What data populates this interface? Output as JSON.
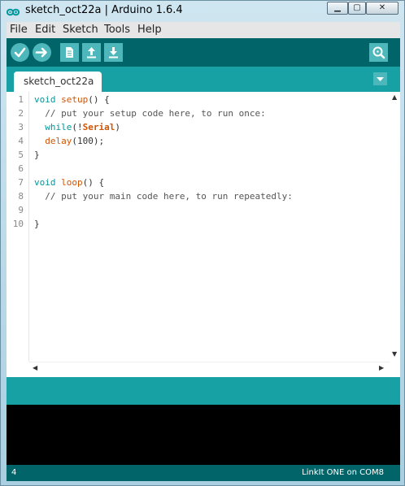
{
  "window": {
    "title": "sketch_oct22a | Arduino 1.6.4",
    "minimize": "▁",
    "maximize": "▢",
    "close": "✕"
  },
  "menu": [
    "File",
    "Edit",
    "Sketch",
    "Tools",
    "Help"
  ],
  "toolbar": {
    "buttons": [
      "verify-icon",
      "upload-icon",
      "new-icon",
      "open-icon",
      "save-icon",
      "serial-monitor-icon"
    ]
  },
  "tab": {
    "label": "sketch_oct22a §"
  },
  "editor": {
    "line_numbers": [
      "1",
      "2",
      "3",
      "4",
      "5",
      "6",
      "7",
      "8",
      "9",
      "10"
    ],
    "lines": [
      "void setup() {",
      "  // put your setup code here, to run once:",
      "  while(!Serial)",
      "  delay(100);",
      "}",
      "",
      "void loop() {",
      "  // put your main code here, to run repeatedly:",
      "",
      "}"
    ]
  },
  "status": {
    "line": "4",
    "board": "LinkIt ONE on COM8"
  },
  "colors": {
    "toolbar": "#006468",
    "tabs": "#17a1a5",
    "button": "#4db7bb",
    "keyword": "#00979c",
    "function": "#d35400"
  }
}
